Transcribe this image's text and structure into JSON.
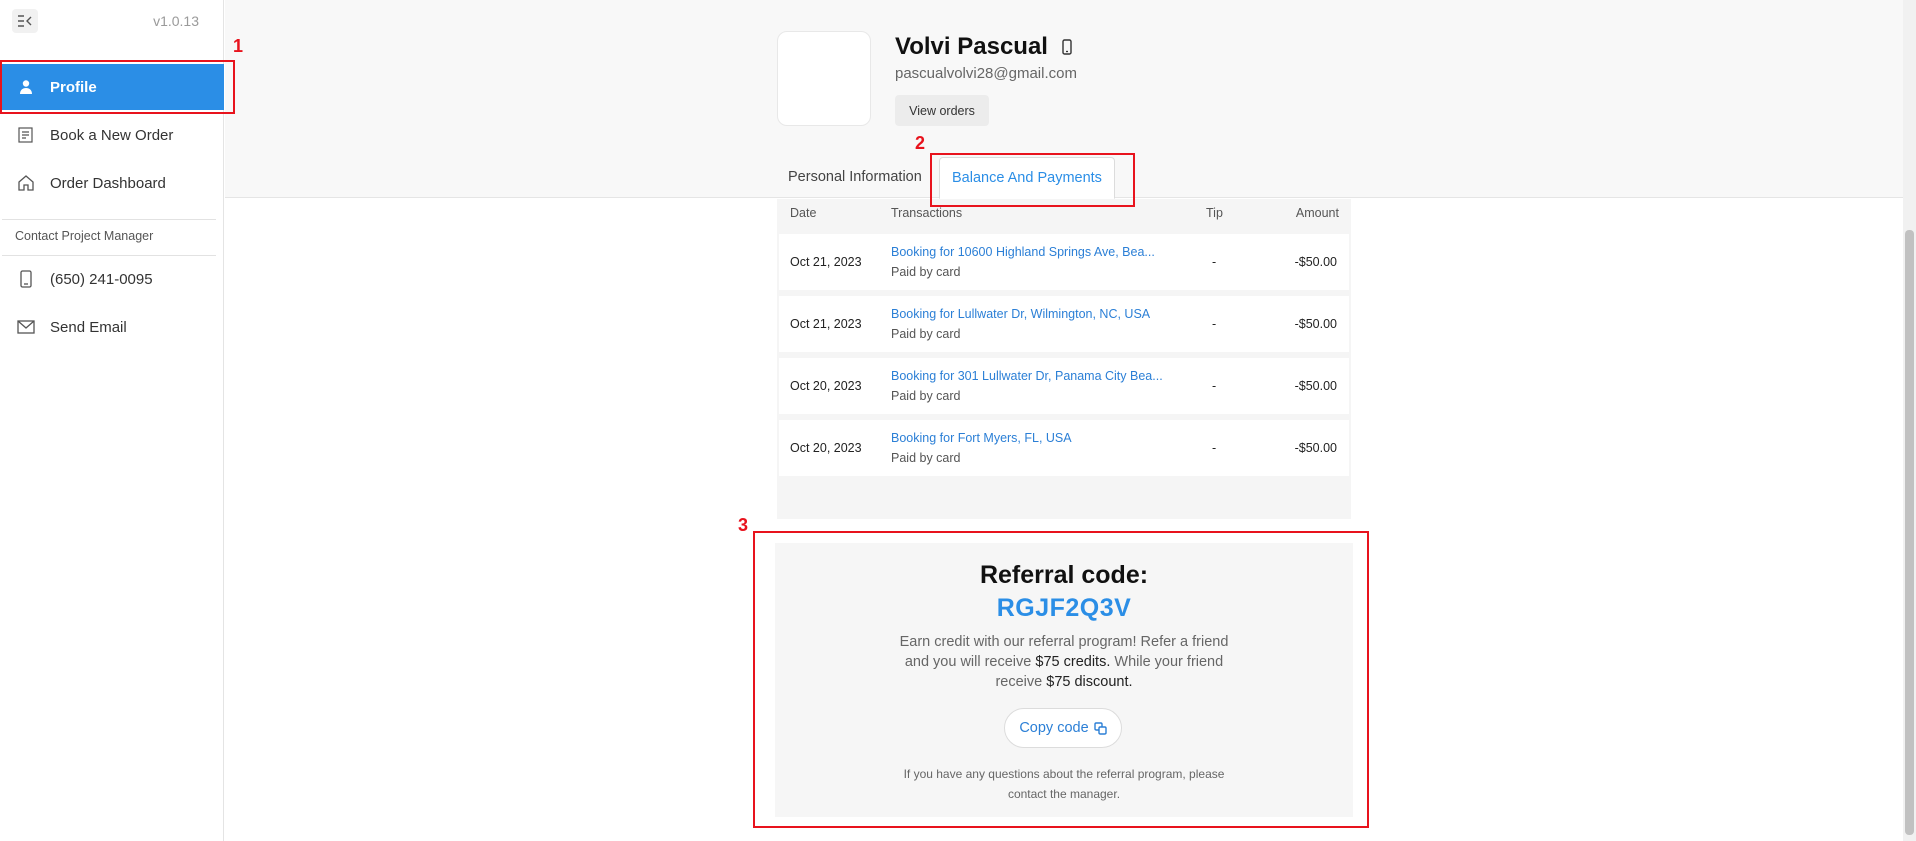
{
  "sidebar": {
    "version": "v1.0.13",
    "items": [
      {
        "label": "Profile",
        "icon": "user-icon"
      },
      {
        "label": "Book a New Order",
        "icon": "order-form-icon"
      },
      {
        "label": "Order Dashboard",
        "icon": "home-icon"
      }
    ],
    "contact_title": "Contact Project Manager",
    "contact": [
      {
        "label": "(650) 241-0095",
        "icon": "phone-icon"
      },
      {
        "label": "Send Email",
        "icon": "envelope-icon"
      }
    ]
  },
  "profile": {
    "name": "Volvi Pascual",
    "email": "pascualvolvi28@gmail.com",
    "view_orders": "View orders"
  },
  "tabs": [
    {
      "label": "Personal Information",
      "active": false
    },
    {
      "label": "Balance And Payments",
      "active": true
    }
  ],
  "table": {
    "headers": {
      "date": "Date",
      "transactions": "Transactions",
      "tip": "Tip",
      "amount": "Amount"
    },
    "rows": [
      {
        "date": "Oct 21, 2023",
        "transaction": "Booking for 10600 Highland Springs Ave, Bea...",
        "method": "Paid by card",
        "tip": "-",
        "amount": "-$50.00"
      },
      {
        "date": "Oct 21, 2023",
        "transaction": "Booking for Lullwater Dr, Wilmington, NC, USA",
        "method": "Paid by card",
        "tip": "-",
        "amount": "-$50.00"
      },
      {
        "date": "Oct 20, 2023",
        "transaction": "Booking for 301 Lullwater Dr, Panama City Bea...",
        "method": "Paid by card",
        "tip": "-",
        "amount": "-$50.00"
      },
      {
        "date": "Oct 20, 2023",
        "transaction": "Booking for Fort Myers, FL, USA",
        "method": "Paid by card",
        "tip": "-",
        "amount": "-$50.00"
      }
    ]
  },
  "referral": {
    "title": "Referral code:",
    "code": "RGJF2Q3V",
    "desc_1": "Earn credit with our referral program! Refer a friend and you will receive ",
    "credits": "$75 credits.",
    "desc_2": " While your friend receive ",
    "discount": "$75 discount.",
    "copy_label": "Copy code",
    "note": "If you have any questions about the referral program, please contact the manager."
  },
  "annotations": [
    "1",
    "2",
    "3"
  ],
  "colors": {
    "accent": "#2b8ee6",
    "annotation": "#e8131d"
  }
}
